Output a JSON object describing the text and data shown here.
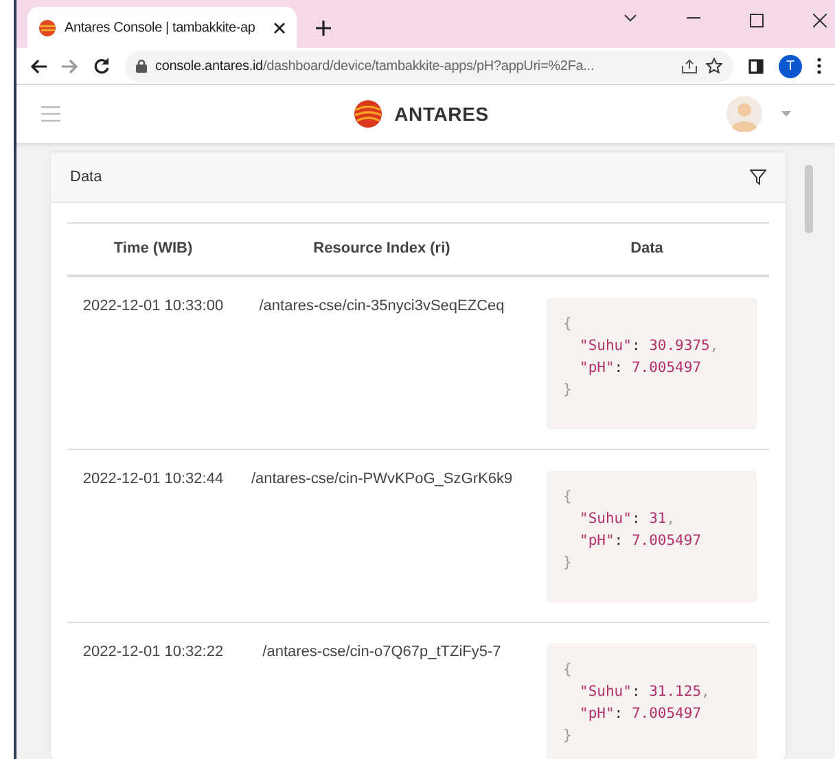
{
  "browser": {
    "tab_title": "Antares Console | tambakkite-ap",
    "url_domain": "console.antares.id",
    "url_path": "/dashboard/device/tambakkite-apps/pH?appUri=%2Fa...",
    "profile_initial": "T"
  },
  "app": {
    "brand": "ANTARES"
  },
  "card": {
    "title": "Data",
    "columns": [
      "Time (WIB)",
      "Resource Index (ri)",
      "Data"
    ],
    "rows": [
      {
        "time": "2022-12-01 10:33:00",
        "ri": "/antares-cse/cin-35nyci3vSeqEZCeq",
        "open": "{",
        "close": "}",
        "entries": [
          {
            "key": "\"Suhu\"",
            "sep": ":",
            "value": "30.9375",
            "comma": ","
          },
          {
            "key": "\"pH\"",
            "sep": ":",
            "value": "7.005497"
          }
        ]
      },
      {
        "time": "2022-12-01 10:32:44",
        "ri": "/antares-cse/cin-PWvKPoG_SzGrK6k9",
        "open": "{",
        "close": "}",
        "entries": [
          {
            "key": "\"Suhu\"",
            "sep": ":",
            "value": "31",
            "comma": ","
          },
          {
            "key": "\"pH\"",
            "sep": ":",
            "value": "7.005497"
          }
        ]
      },
      {
        "time": "2022-12-01 10:32:22",
        "ri": "/antares-cse/cin-o7Q67p_tTZiFy5-7",
        "open": "{",
        "close": "}",
        "entries": [
          {
            "key": "\"Suhu\"",
            "sep": ":",
            "value": "31.125",
            "comma": ","
          },
          {
            "key": "\"pH\"",
            "sep": ":",
            "value": "7.005497"
          }
        ]
      }
    ]
  }
}
